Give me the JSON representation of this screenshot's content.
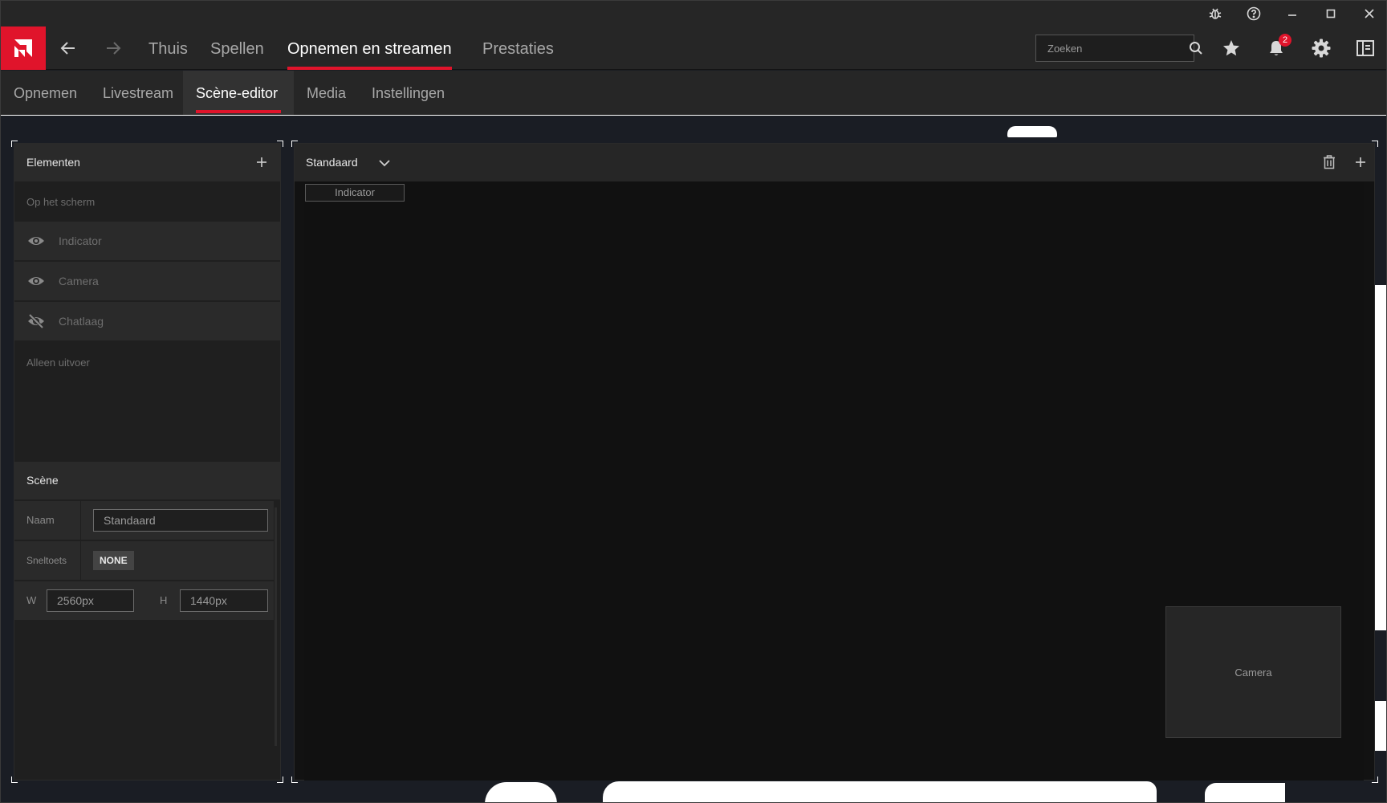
{
  "nav": {
    "tabs": [
      "Thuis",
      "Spellen",
      "Opnemen en streamen",
      "Prestaties"
    ],
    "active_tab": 2,
    "search_placeholder": "Zoeken",
    "notification_count": "2"
  },
  "subnav": {
    "tabs": [
      "Opnemen",
      "Livestream",
      "Scène-editor",
      "Media",
      "Instellingen"
    ],
    "active_tab": 2
  },
  "elements_panel": {
    "title": "Elementen",
    "on_screen_label": "Op het scherm",
    "items": [
      {
        "label": "Indicator",
        "visible": true
      },
      {
        "label": "Camera",
        "visible": true
      },
      {
        "label": "Chatlaag",
        "visible": false
      }
    ],
    "output_only_label": "Alleen uitvoer"
  },
  "scene_panel": {
    "title": "Scène",
    "name_label": "Naam",
    "name_value": "Standaard",
    "hotkey_label": "Sneltoets",
    "hotkey_value": "NONE",
    "width_label": "W",
    "width_value": "2560px",
    "height_label": "H",
    "height_value": "1440px"
  },
  "preview": {
    "scene_name": "Standaard",
    "indicator_label": "Indicator",
    "camera_label": "Camera"
  },
  "colors": {
    "accent": "#e0142b",
    "panel_bg": "#262626",
    "window_bg": "#1b1d22"
  }
}
